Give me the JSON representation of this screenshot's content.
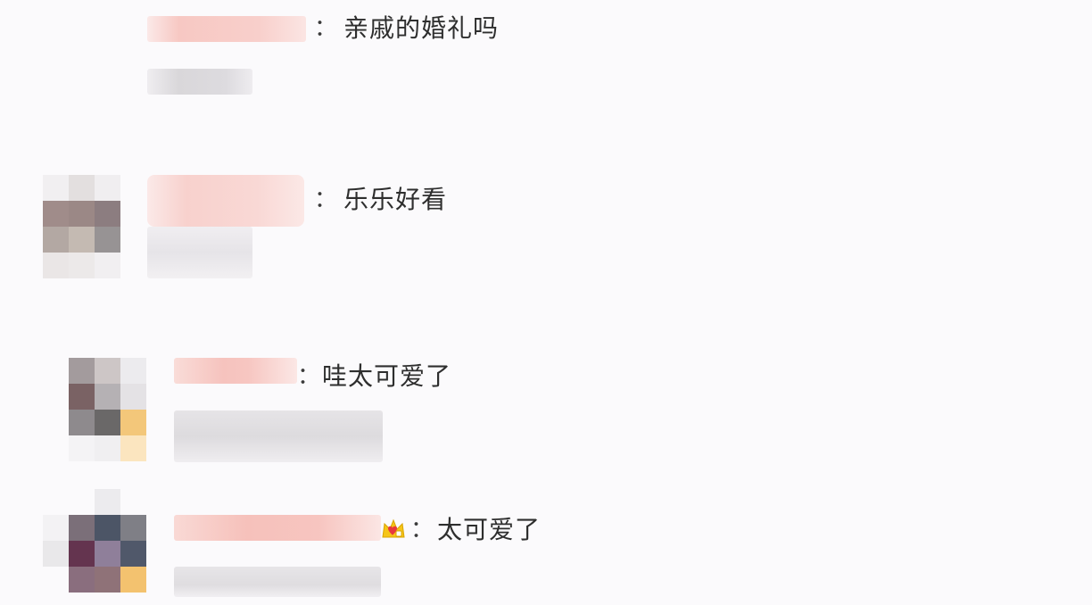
{
  "comments": [
    {
      "separator": "：",
      "text": "亲戚的婚礼吗"
    },
    {
      "separator": "：",
      "text": "乐乐好看"
    },
    {
      "separator": "：",
      "text": "哇太可爱了"
    },
    {
      "separator": "：",
      "text": "太可爱了",
      "badge_icon": "crown-badge-icon"
    }
  ],
  "colors": {
    "background": "#fbfafc",
    "text": "#2e2e2e",
    "name_blur": "#f7cbc6",
    "sub_blur": "#e3e1e5",
    "badge_gold": "#f5c518",
    "badge_red": "#e8383c"
  }
}
